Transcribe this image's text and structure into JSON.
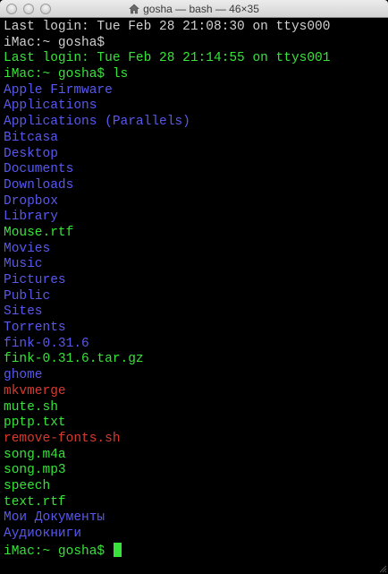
{
  "window": {
    "title": "gosha — bash — 46×35"
  },
  "icons": {
    "title_icon": "home-icon",
    "corner": "resize-grip-icon"
  },
  "colors": {
    "background": "#000000",
    "gray_text": "#cfcfcf",
    "green_text": "#37e23a",
    "blue_text": "#5858ef",
    "red_text": "#d63a2e"
  },
  "terminal": {
    "lines": [
      {
        "text": "Last login: Tue Feb 28 21:08:30 on ttys000",
        "color": "gray"
      },
      {
        "text": "iMac:~ gosha$",
        "color": "gray"
      },
      {
        "text": "Last login: Tue Feb 28 21:14:55 on ttys001",
        "color": "green"
      },
      {
        "text": "iMac:~ gosha$ ls",
        "color": "green"
      },
      {
        "text": "Apple Firmware",
        "color": "blue"
      },
      {
        "text": "Applications",
        "color": "blue"
      },
      {
        "text": "Applications (Parallels)",
        "color": "blue"
      },
      {
        "text": "Bitcasa",
        "color": "blue"
      },
      {
        "text": "Desktop",
        "color": "blue"
      },
      {
        "text": "Documents",
        "color": "blue"
      },
      {
        "text": "Downloads",
        "color": "blue"
      },
      {
        "text": "Dropbox",
        "color": "blue"
      },
      {
        "text": "Library",
        "color": "blue"
      },
      {
        "text": "Mouse.rtf",
        "color": "green"
      },
      {
        "text": "Movies",
        "color": "blue"
      },
      {
        "text": "Music",
        "color": "blue"
      },
      {
        "text": "Pictures",
        "color": "blue"
      },
      {
        "text": "Public",
        "color": "blue"
      },
      {
        "text": "Sites",
        "color": "blue"
      },
      {
        "text": "Torrents",
        "color": "blue"
      },
      {
        "text": "fink-0.31.6",
        "color": "blue"
      },
      {
        "text": "fink-0.31.6.tar.gz",
        "color": "green"
      },
      {
        "text": "ghome",
        "color": "blue"
      },
      {
        "text": "mkvmerge",
        "color": "red"
      },
      {
        "text": "mute.sh",
        "color": "green"
      },
      {
        "text": "pptp.txt",
        "color": "green"
      },
      {
        "text": "remove-fonts.sh",
        "color": "red"
      },
      {
        "text": "song.m4a",
        "color": "green"
      },
      {
        "text": "song.mp3",
        "color": "green"
      },
      {
        "text": "speech",
        "color": "green"
      },
      {
        "text": "text.rtf",
        "color": "green"
      },
      {
        "text": "Мои Документы",
        "color": "blue"
      },
      {
        "text": "Аудиокниги",
        "color": "blue"
      }
    ],
    "prompt": "iMac:~ gosha$ "
  }
}
